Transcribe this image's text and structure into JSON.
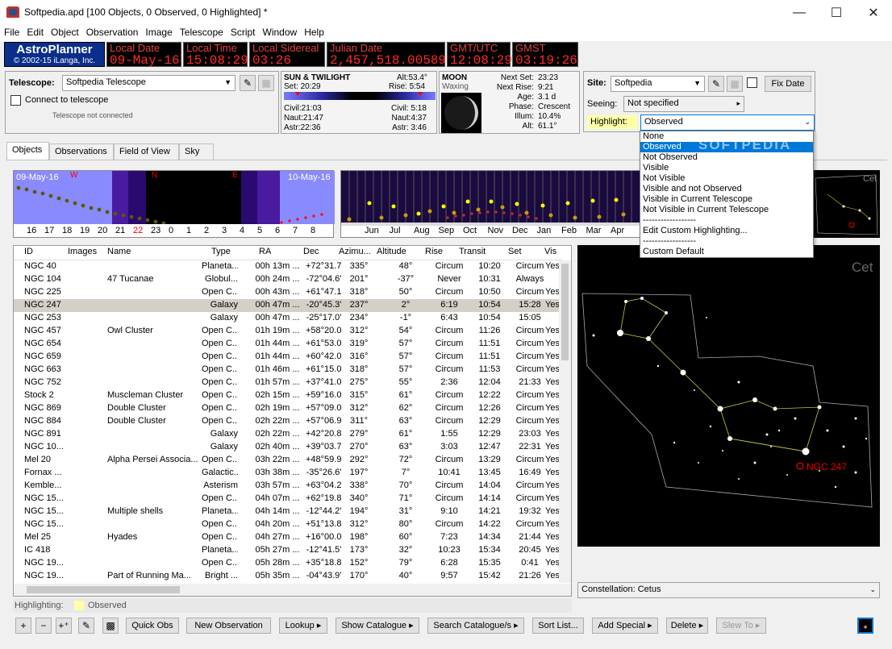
{
  "window": {
    "title": "Softpedia.apd [100 Objects, 0 Observed, 0 Highlighted] *"
  },
  "menu": [
    "File",
    "Edit",
    "Object",
    "Observation",
    "Image",
    "Telescope",
    "Script",
    "Window",
    "Help"
  ],
  "logo": {
    "name": "AstroPlanner",
    "copyright": "© 2002-15 iLanga, Inc."
  },
  "clocks": [
    {
      "label": "Local Date",
      "value": "09-May-16"
    },
    {
      "label": "Local Time",
      "value": "15:08:29"
    },
    {
      "label": "Local Sidereal",
      "value": "03:26"
    },
    {
      "label": "Julian Date",
      "value": "2,457,518.00589"
    },
    {
      "label": "GMT/UTC",
      "value": "12:08:29"
    },
    {
      "label": "GMST",
      "value": "03:19:26"
    }
  ],
  "telescope": {
    "label": "Telescope:",
    "value": "Softpedia Telescope",
    "connect_label": "Connect to telescope",
    "status": "Telescope not connected"
  },
  "sun": {
    "title": "SUN & TWILIGHT",
    "alt_label": "Alt:",
    "alt": "53.4°",
    "set_label": "Set:",
    "set": "20:29",
    "rise_label": "Rise:",
    "rise": "5:54",
    "civil_label": "Civil:",
    "civil_set": "21:03",
    "naut_label": "Naut:",
    "naut_set": "21:47",
    "astr_label": "Astr:",
    "astr_set": "22:36",
    "civil_rise": "5:18",
    "naut_rise": "4:37",
    "astr_rise": "3:46"
  },
  "moon": {
    "title": "MOON",
    "phase_name": "Waxing",
    "next_set_label": "Next Set:",
    "next_set": "23:23",
    "next_rise_label": "Next Rise:",
    "next_rise": "9:21",
    "age_label": "Age:",
    "age": "3.1 d",
    "phase_label": "Phase:",
    "phase": "Crescent",
    "illum_label": "Illum:",
    "illum": "10.4%",
    "alt_label": "Alt:",
    "alt": "61.1°"
  },
  "site": {
    "label": "Site:",
    "value": "Softpedia",
    "fix_date": "Fix Date",
    "seeing_label": "Seeing:",
    "seeing": "Not specified",
    "highlight_label": "Highlight:",
    "highlight": "Observed"
  },
  "highlight_options": [
    "None",
    "Observed",
    "Not Observed",
    "Visible",
    "Not Visible",
    "Visible and not Observed",
    "Visible in Current Telescope",
    "Not Visible in Current Telescope",
    "------------------",
    "Edit Custom Highlighting...",
    "------------------",
    "Custom Default"
  ],
  "tabs": [
    "Objects",
    "Observations",
    "Field of View",
    "Sky"
  ],
  "altchart": {
    "date_left": "09-May-16",
    "date_right": "10-May-16",
    "dir_w": "W",
    "dir_n": "N",
    "dir_e": "E",
    "hours": [
      "16",
      "17",
      "18",
      "19",
      "20",
      "21",
      "22",
      "23",
      "0",
      "1",
      "2",
      "3",
      "4",
      "5",
      "6",
      "7",
      "8"
    ]
  },
  "yearchart": {
    "months": [
      "Jun",
      "Jul",
      "Aug",
      "Sep",
      "Oct",
      "Nov",
      "Dec",
      "Jan",
      "Feb",
      "Mar",
      "Apr"
    ]
  },
  "minisky": {
    "label": "Cet"
  },
  "columns": [
    "ID",
    "Images",
    "Name",
    "Type",
    "RA",
    "Dec",
    "Azimu...",
    "Altitude",
    "Rise",
    "Transit",
    "Set",
    "Vis"
  ],
  "rows": [
    [
      "NGC 40",
      "",
      "",
      "Planeta...",
      "00h 13m ...",
      "+72°31.7'",
      "335°",
      "48°",
      "Circum",
      "10:20",
      "Circum",
      "Yes"
    ],
    [
      "NGC 104",
      "",
      "47 Tucanae",
      "Globul...",
      "00h 24m ...",
      "-72°04.6'",
      "201°",
      "-37°",
      "Never",
      "10:31",
      "Always",
      ""
    ],
    [
      "NGC 225",
      "",
      "",
      "Open C...",
      "00h 43m ...",
      "+61°47.1'",
      "318°",
      "50°",
      "Circum",
      "10:50",
      "Circum",
      "Yes"
    ],
    [
      "NGC 247",
      "",
      "",
      "Galaxy",
      "00h 47m ...",
      "-20°45.3'",
      "237°",
      "2°",
      "6:19",
      "10:54",
      "15:28",
      "Yes"
    ],
    [
      "NGC 253",
      "",
      "",
      "Galaxy",
      "00h 47m ...",
      "-25°17.0'",
      "234°",
      "-1°",
      "6:43",
      "10:54",
      "15:05",
      ""
    ],
    [
      "NGC 457",
      "",
      "Owl Cluster",
      "Open C...",
      "01h 19m ...",
      "+58°20.0'",
      "312°",
      "54°",
      "Circum",
      "11:26",
      "Circum",
      "Yes"
    ],
    [
      "NGC 654",
      "",
      "",
      "Open C...",
      "01h 44m ...",
      "+61°53.0'",
      "319°",
      "57°",
      "Circum",
      "11:51",
      "Circum",
      "Yes"
    ],
    [
      "NGC 659",
      "",
      "",
      "Open C...",
      "01h 44m ...",
      "+60°42.0'",
      "316°",
      "57°",
      "Circum",
      "11:51",
      "Circum",
      "Yes"
    ],
    [
      "NGC 663",
      "",
      "",
      "Open C...",
      "01h 46m ...",
      "+61°15.0'",
      "318°",
      "57°",
      "Circum",
      "11:53",
      "Circum",
      "Yes"
    ],
    [
      "NGC 752",
      "",
      "",
      "Open C...",
      "01h 57m ...",
      "+37°41.0'",
      "275°",
      "55°",
      "2:36",
      "12:04",
      "21:33",
      "Yes"
    ],
    [
      "Stock 2",
      "",
      "Muscleman Cluster",
      "Open C...",
      "02h 15m ...",
      "+59°16.0'",
      "315°",
      "61°",
      "Circum",
      "12:22",
      "Circum",
      "Yes"
    ],
    [
      "NGC 869",
      "",
      "Double Cluster",
      "Open C...",
      "02h 19m ...",
      "+57°09.0'",
      "312°",
      "62°",
      "Circum",
      "12:26",
      "Circum",
      "Yes"
    ],
    [
      "NGC 884",
      "",
      "Double Cluster",
      "Open C...",
      "02h 22m ...",
      "+57°06.9'",
      "311°",
      "63°",
      "Circum",
      "12:29",
      "Circum",
      "Yes"
    ],
    [
      "NGC 891",
      "",
      "",
      "Galaxy",
      "02h 22m ...",
      "+42°20.8'",
      "279°",
      "61°",
      "1:55",
      "12:29",
      "23:03",
      "Yes"
    ],
    [
      "NGC 10...",
      "",
      "",
      "Galaxy",
      "02h 40m ...",
      "+39°03.7'",
      "270°",
      "63°",
      "3:03",
      "12:47",
      "22:31",
      "Yes"
    ],
    [
      "Mel 20",
      "",
      "Alpha Persei Associa...",
      "Open C...",
      "03h 22m ...",
      "+48°59.9'",
      "292°",
      "72°",
      "Circum",
      "13:29",
      "Circum",
      "Yes"
    ],
    [
      "Fornax ...",
      "",
      "",
      "Galactic...",
      "03h 38m ...",
      "-35°26.6'",
      "197°",
      "7°",
      "10:41",
      "13:45",
      "16:49",
      "Yes"
    ],
    [
      "Kemble...",
      "",
      "",
      "Asterism",
      "03h 57m ...",
      "+63°04.2'",
      "338°",
      "70°",
      "Circum",
      "14:04",
      "Circum",
      "Yes"
    ],
    [
      "NGC 15...",
      "",
      "",
      "Open C...",
      "04h 07m ...",
      "+62°19.8'",
      "340°",
      "71°",
      "Circum",
      "14:14",
      "Circum",
      "Yes"
    ],
    [
      "NGC 15...",
      "",
      "Multiple shells",
      "Planeta...",
      "04h 14m ...",
      "-12°44.2'",
      "194°",
      "31°",
      "9:10",
      "14:21",
      "19:32",
      "Yes"
    ],
    [
      "NGC 15...",
      "",
      "",
      "Open C...",
      "04h 20m ...",
      "+51°13.8'",
      "312°",
      "80°",
      "Circum",
      "14:22",
      "Circum",
      "Yes"
    ],
    [
      "Mel 25",
      "",
      "Hyades",
      "Open C...",
      "04h 27m ...",
      "+16°00.0'",
      "198°",
      "60°",
      "7:23",
      "14:34",
      "21:44",
      "Yes"
    ],
    [
      "IC 418",
      "",
      "",
      "Planeta...",
      "05h 27m ...",
      "-12°41.5'",
      "173°",
      "32°",
      "10:23",
      "15:34",
      "20:45",
      "Yes"
    ],
    [
      "NGC 19...",
      "",
      "",
      "Open C...",
      "05h 28m ...",
      "+35°18.8'",
      "152°",
      "79°",
      "6:28",
      "15:35",
      "0:41",
      "Yes"
    ],
    [
      "NGC 19...",
      "",
      "Part of Running Ma...",
      "Bright ...",
      "05h 35m ...",
      "-04°43.9'",
      "170°",
      "40°",
      "9:57",
      "15:42",
      "21:26",
      "Yes"
    ]
  ],
  "selected_row": 3,
  "status": {
    "highlighting_label": "Highlighting:",
    "highlighting_value": "Observed"
  },
  "skymap": {
    "constellation_watermark": "Cet",
    "object_label": "NGC 247",
    "constellation_label": "Constellation: Cetus"
  },
  "bottom_buttons": [
    "Quick Obs",
    "New Observation",
    "Lookup",
    "Show Catalogue",
    "Search Catalogue/s",
    "Sort List...",
    "Add Special",
    "Delete",
    "Slew To"
  ],
  "watermark": "SOFTPEDIA"
}
